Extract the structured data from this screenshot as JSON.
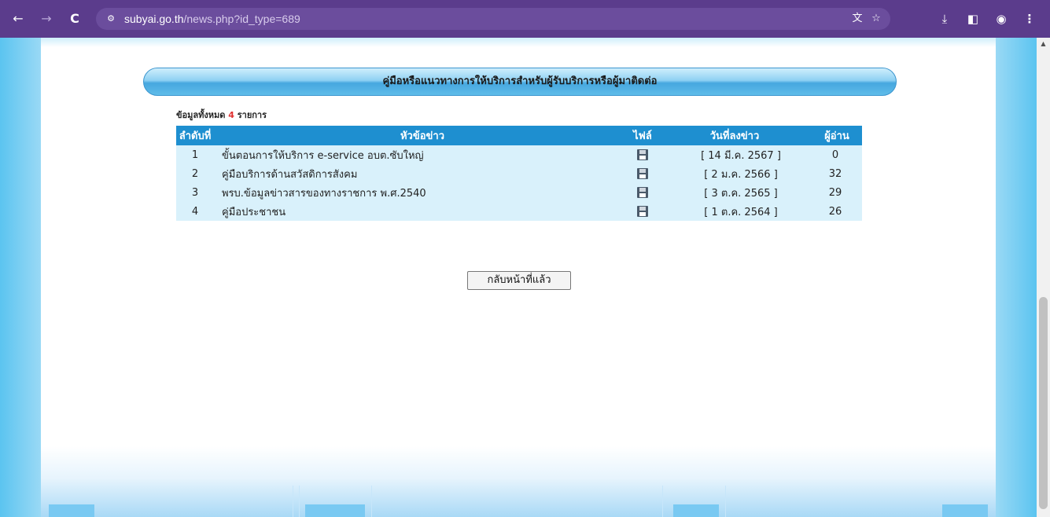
{
  "browser": {
    "url_host": "subyai.go.th",
    "url_path": "/news.php?id_type=689",
    "back_glyph": "←",
    "forward_glyph": "→",
    "reload_glyph": "C",
    "site_settings_glyph": "⚙",
    "translate_glyph": "文",
    "bookmark_glyph": "☆",
    "download_glyph": "⤓",
    "sidepanel_glyph": "◧",
    "profile_glyph": "◉",
    "menu_glyph": "⋮"
  },
  "header": {
    "title": "คู่มือหรือแนวทางการให้บริการสำหรับผู้รับบริการหรือผู้มาติดต่อ"
  },
  "summary": {
    "prefix": "ข้อมูลทั้งหมด",
    "count": "4",
    "suffix": "รายการ"
  },
  "table": {
    "headers": [
      "ลำดับที่",
      "หัวข้อข่าว",
      "ไฟล์",
      "วันที่ลงข่าว",
      "ผู้อ่าน"
    ],
    "rows": [
      {
        "num": "1",
        "title": "ขั้นตอนการให้บริการ e-service อบต.ซับใหญ่",
        "file_icon": "save-icon",
        "date": "[ 14 มี.ค. 2567 ]",
        "readers": "0"
      },
      {
        "num": "2",
        "title": "คู่มือบริการด้านสวัสดิการสังคม",
        "file_icon": "save-icon",
        "date": "[ 2 ม.ค. 2566 ]",
        "readers": "32"
      },
      {
        "num": "3",
        "title": "พรบ.ข้อมูลข่าวสารของทางราชการ พ.ศ.2540",
        "file_icon": "save-icon",
        "date": "[ 3 ต.ค. 2565 ]",
        "readers": "29"
      },
      {
        "num": "4",
        "title": "คู่มือประชาชน",
        "file_icon": "save-icon",
        "date": "[ 1 ต.ค. 2564 ]",
        "readers": "26"
      }
    ]
  },
  "back_button": {
    "label": "กลับหน้าที่แล้ว"
  },
  "scrollbar": {
    "up_glyph": "▲"
  },
  "colors": {
    "chrome": "#5b3c8c",
    "table_header": "#1e8fd0",
    "table_row": "#d9f1fb",
    "count_accent": "#e03030"
  }
}
